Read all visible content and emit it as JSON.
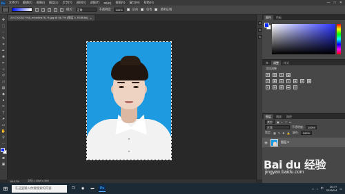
{
  "app": {
    "logo": "Ps"
  },
  "menu": [
    "文件(F)",
    "编辑(E)",
    "图像(I)",
    "图层(L)",
    "文字(Y)",
    "选择(S)",
    "滤镜(T)",
    "3D(D)",
    "视图(V)",
    "窗口(W)",
    "帮助(H)"
  ],
  "window_controls": [
    "—",
    "□",
    "✕"
  ],
  "options": {
    "mode_label": "模式:",
    "mode_value": "正常",
    "opacity_label": "不透明度:",
    "opacity_value": "100%",
    "reverse_label": "反向",
    "dither_label": "仿色",
    "transparency_label": "透明区域"
  },
  "document": {
    "tab_title": "201702052??65_mhm0ns76_%.jpg @ 66.7% (图层 0, RGB/8#)",
    "close": "×"
  },
  "status": {
    "zoom": "66.67%",
    "doc_size": "文档:1.05M/1.05M"
  },
  "panels": {
    "color_tabs": [
      "颜色",
      "色板"
    ],
    "adjust_tabs": [
      "库",
      "调整",
      "样式"
    ],
    "adjust_title": "添加调整",
    "layer_tabs": [
      "图层",
      "通道",
      "路径"
    ],
    "kind_label": "类型",
    "blend_mode": "正常",
    "opacity_label": "不透明度:",
    "opacity_value": "100%",
    "lock_label": "锁定:",
    "fill_label": "填充:",
    "fill_value": "100%",
    "layer_name": "图层 0",
    "layer_footer": [
      "⛓",
      "fx",
      "◐",
      "▣",
      "▭",
      "🗑"
    ]
  },
  "taskbar": {
    "search_placeholder": "在这里输入你要搜索的内容",
    "tray_text": "中",
    "time": "20:??",
    "date": "2018/2/4"
  },
  "watermark": {
    "logo": "Bai du 经验",
    "url": "jingyan.baidu.com"
  },
  "colors": {
    "foreground": "#0026ff",
    "background": "#ffffff",
    "photo_bg": "#1e9ae0"
  }
}
